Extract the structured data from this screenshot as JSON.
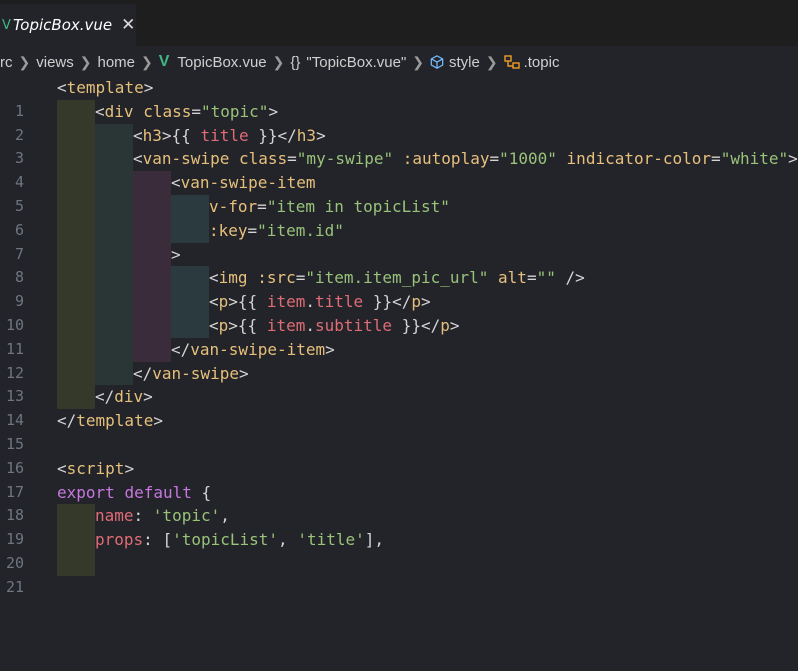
{
  "tab": {
    "title": "TopicBox.vue",
    "icon": "vue-icon",
    "close": "✕"
  },
  "breadcrumb": {
    "items": [
      "rc",
      "views",
      "home",
      "TopicBox.vue",
      "\"TopicBox.vue\"",
      "style",
      ".topic"
    ]
  },
  "editor": {
    "line_numbers": [
      "1",
      "2",
      "3",
      "4",
      "5",
      "6",
      "7",
      "8",
      "9",
      "10",
      "11",
      "12",
      "13",
      "14",
      "15",
      "16",
      "17",
      "18",
      "19",
      "20",
      "21"
    ],
    "lines": [
      "<template>",
      "<div class=\"topic\">",
      "<h3>{{ title }}</h3>",
      "<van-swipe class=\"my-swipe\" :autoplay=\"1000\" indicator-color=\"white\">",
      "<van-swipe-item",
      "v-for=\"item in topicList\"",
      ":key=\"item.id\"",
      ">",
      "<img :src=\"item.item_pic_url\" alt=\"\" />",
      "<p>{{ item.title }}</p>",
      "<p>{{ item.subtitle }}</p>",
      "</van-swipe-item>",
      "</van-swipe>",
      "</div>",
      "</template>",
      "",
      "<script>",
      "export default {",
      "name: 'topic',",
      "props: ['topicList', 'title'],",
      ""
    ]
  },
  "colors": {
    "vue_green": "#41b883",
    "background": "#23232a"
  }
}
